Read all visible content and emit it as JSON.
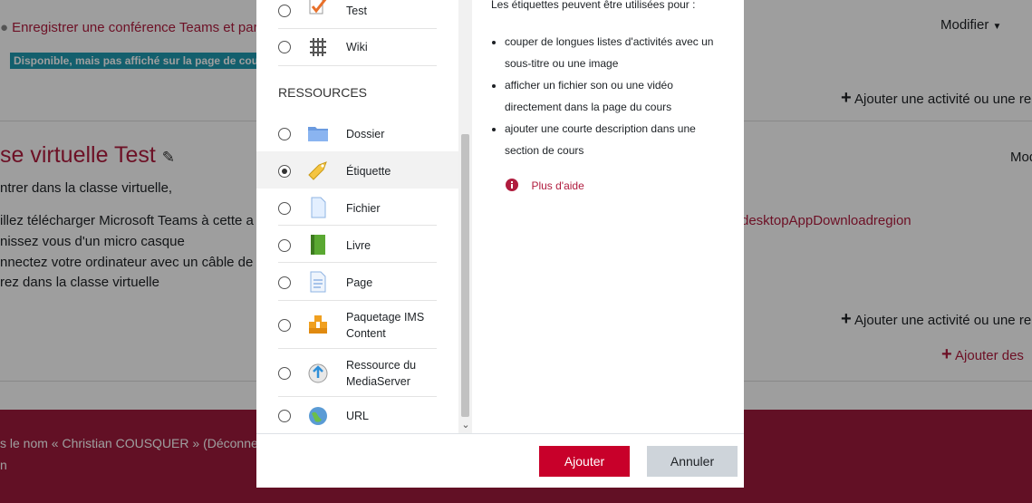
{
  "background": {
    "activity_link": "Enregistrer une conférence Teams et parta",
    "availability_badge": "Disponible, mais pas affiché sur la page de cours",
    "modify_menu_1": "Modifier",
    "modify_menu_2": "Mod",
    "add_activity_1": "Ajouter une activité ou une re",
    "add_activity_2": "Ajouter une activité ou une re",
    "add_sections": "Ajouter des",
    "section_title": "se virtuelle Test",
    "section_lines": [
      "ntrer dans la classe virtuelle,",
      "illez télécharger Microsoft Teams à cette a",
      "nissez vous d'un micro casque",
      "nnectez votre ordinateur avec un câble de p",
      "rez dans la classe virtuelle"
    ],
    "download_link": "desktopAppDownloadregion",
    "footer_login": "s le nom « Christian COUSQUER » (Déconne",
    "footer_line2": "n"
  },
  "chooser": {
    "resources_heading": "RESSOURCES",
    "activities": [
      {
        "label": "Test",
        "icon": "quiz-icon"
      },
      {
        "label": "Wiki",
        "icon": "wiki-icon"
      }
    ],
    "resources": [
      {
        "label": "Dossier",
        "icon": "folder-icon"
      },
      {
        "label": "Étiquette",
        "icon": "label-icon"
      },
      {
        "label": "Fichier",
        "icon": "file-icon"
      },
      {
        "label": "Livre",
        "icon": "book-icon"
      },
      {
        "label": "Page",
        "icon": "page-icon"
      },
      {
        "label": "Paquetage IMS Content",
        "icon": "ims-package-icon"
      },
      {
        "label": "Ressource du MediaServer",
        "icon": "mediaserver-icon"
      },
      {
        "label": "URL",
        "icon": "url-icon"
      }
    ],
    "selected": "Étiquette",
    "help": {
      "intro": "Les étiquettes peuvent être utilisées pour :",
      "bullets": [
        "couper de longues listes d'activités avec un sous-titre ou une image",
        "afficher un fichier son ou une vidéo directement dans la page du cours",
        "ajouter une courte description dans une section de cours"
      ],
      "more_help": "Plus d'aide"
    },
    "add_button": "Ajouter",
    "cancel_button": "Annuler"
  },
  "colors": {
    "brand": "#9e1a3c",
    "primary_button": "#c8002a",
    "badge": "#1f9ab0"
  }
}
